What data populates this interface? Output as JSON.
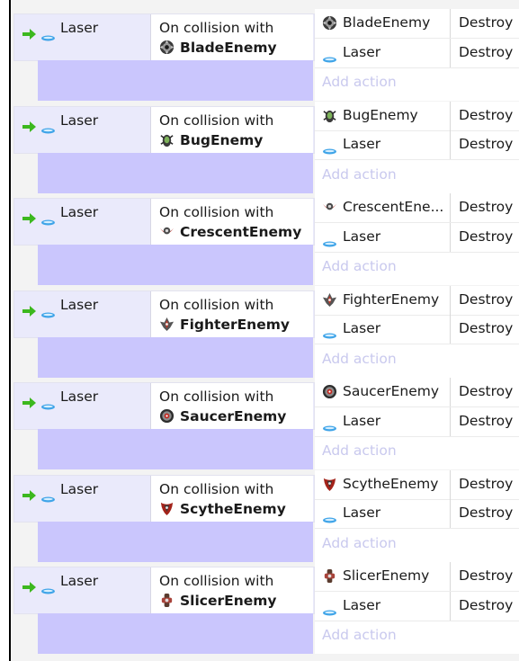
{
  "colors": {
    "event_background": "#eaeafb",
    "sub_event_strip": "#cac6fd",
    "add_action_text": "#c9c9ee",
    "trigger_arrow": "#3cb81e",
    "laser_blue": "#3fa4e8"
  },
  "events": [
    {
      "trigger_object": "Laser",
      "condition_text": "On collision with",
      "condition_object": "BladeEnemy",
      "enemy_icon": "blade-enemy-icon",
      "actions": [
        {
          "object": "BladeEnemy",
          "icon": "blade-enemy-icon",
          "action": "Destroy"
        },
        {
          "object": "Laser",
          "icon": "laser-icon",
          "action": "Destroy"
        }
      ],
      "add_action": "Add action"
    },
    {
      "trigger_object": "Laser",
      "condition_text": "On collision with",
      "condition_object": "BugEnemy",
      "enemy_icon": "bug-enemy-icon",
      "actions": [
        {
          "object": "BugEnemy",
          "icon": "bug-enemy-icon",
          "action": "Destroy"
        },
        {
          "object": "Laser",
          "icon": "laser-icon",
          "action": "Destroy"
        }
      ],
      "add_action": "Add action"
    },
    {
      "trigger_object": "Laser",
      "condition_text": "On collision with",
      "condition_object": "CrescentEnemy",
      "enemy_icon": "crescent-enemy-icon",
      "actions": [
        {
          "object": "CrescentEne...",
          "icon": "crescent-enemy-icon",
          "action": "Destroy"
        },
        {
          "object": "Laser",
          "icon": "laser-icon",
          "action": "Destroy"
        }
      ],
      "add_action": "Add action"
    },
    {
      "trigger_object": "Laser",
      "condition_text": "On collision with",
      "condition_object": "FighterEnemy",
      "enemy_icon": "fighter-enemy-icon",
      "actions": [
        {
          "object": "FighterEnemy",
          "icon": "fighter-enemy-icon",
          "action": "Destroy"
        },
        {
          "object": "Laser",
          "icon": "laser-icon",
          "action": "Destroy"
        }
      ],
      "add_action": "Add action"
    },
    {
      "trigger_object": "Laser",
      "condition_text": "On collision with",
      "condition_object": "SaucerEnemy",
      "enemy_icon": "saucer-enemy-icon",
      "actions": [
        {
          "object": "SaucerEnemy",
          "icon": "saucer-enemy-icon",
          "action": "Destroy"
        },
        {
          "object": "Laser",
          "icon": "laser-icon",
          "action": "Destroy"
        }
      ],
      "add_action": "Add action"
    },
    {
      "trigger_object": "Laser",
      "condition_text": "On collision with",
      "condition_object": "ScytheEnemy",
      "enemy_icon": "scythe-enemy-icon",
      "actions": [
        {
          "object": "ScytheEnemy",
          "icon": "scythe-enemy-icon",
          "action": "Destroy"
        },
        {
          "object": "Laser",
          "icon": "laser-icon",
          "action": "Destroy"
        }
      ],
      "add_action": "Add action"
    },
    {
      "trigger_object": "Laser",
      "condition_text": "On collision with",
      "condition_object": "SlicerEnemy",
      "enemy_icon": "slicer-enemy-icon",
      "actions": [
        {
          "object": "SlicerEnemy",
          "icon": "slicer-enemy-icon",
          "action": "Destroy"
        },
        {
          "object": "Laser",
          "icon": "laser-icon",
          "action": "Destroy"
        }
      ],
      "add_action": "Add action"
    }
  ]
}
